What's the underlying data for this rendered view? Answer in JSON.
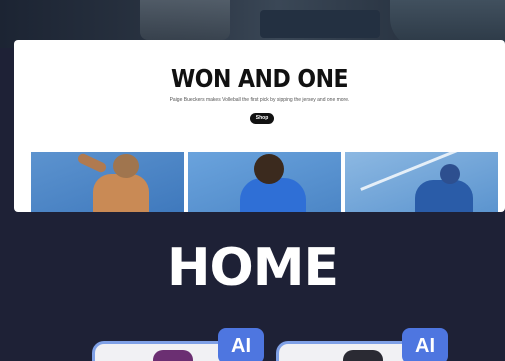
{
  "card": {
    "title": "WON AND ONE",
    "subtitle": "Paige Bueckers makes Volleball the first pick by sipping the jersey and one more.",
    "shop_label": "Shop"
  },
  "home": {
    "title": "HOME"
  },
  "ai_cards": [
    {
      "badge": "AI"
    },
    {
      "badge": "AI"
    }
  ],
  "colors": {
    "background": "#1e2136",
    "badge": "#4e76e0",
    "card": "#ffffff"
  }
}
